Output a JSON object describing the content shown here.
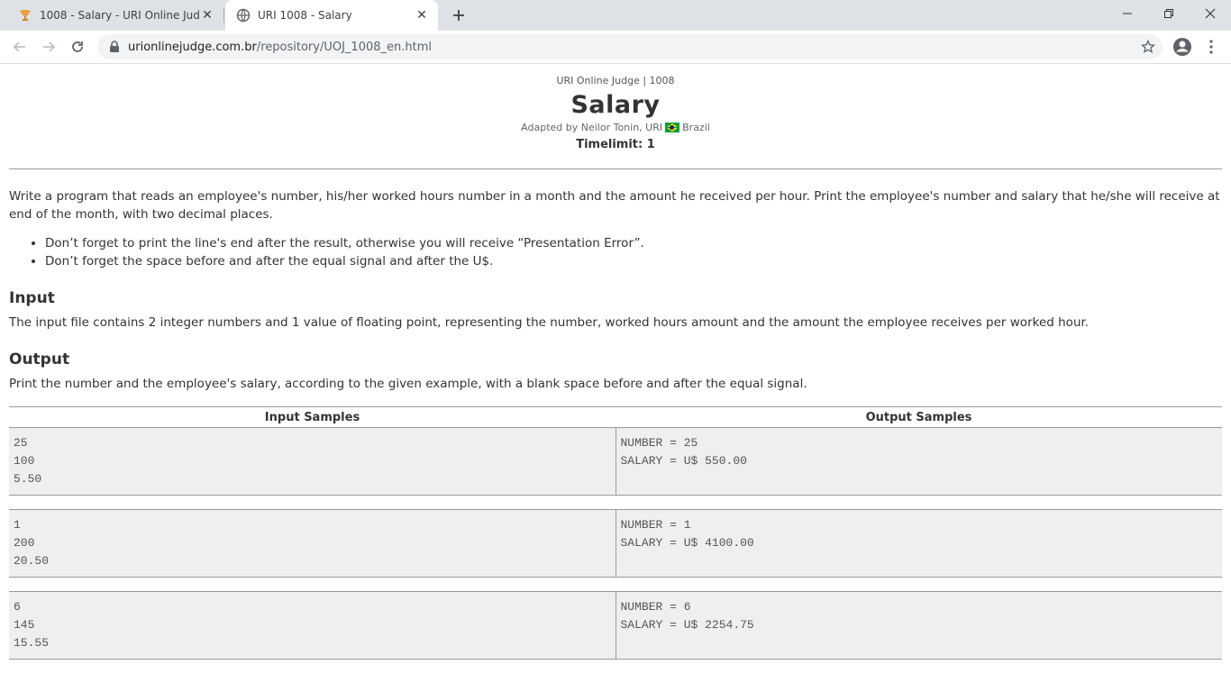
{
  "browser": {
    "tabs": [
      {
        "title": "1008 - Salary - URI Online Judge",
        "active": false
      },
      {
        "title": "URI 1008 - Salary",
        "active": true
      }
    ],
    "url_host": "urionlinejudge.com.br",
    "url_path": "/repository/UOJ_1008_en.html"
  },
  "problem": {
    "crumb": "URI Online Judge | 1008",
    "title": "Salary",
    "author_prefix": "Adapted by Neilor Tonin, URI",
    "country": "Brazil",
    "timelimit": "Timelimit: 1",
    "description": "Write a program that reads an employee's number, his/her worked hours number in a month and the amount he received per hour. Print the employee's number and salary that he/she will receive at end of the month, with two decimal places.",
    "notes": [
      "Don’t forget to print the line's end after the result, otherwise you will receive “Presentation Error”.",
      "Don’t forget the space before and after the equal signal and after the U$."
    ],
    "input_heading": "Input",
    "input_text": "The input file contains 2 integer numbers and 1 value of floating point, representing the number, worked hours amount and the amount the employee receives per worked hour.",
    "output_heading": "Output",
    "output_text": "Print the number and the employee's salary, according to the given example, with a blank space before and after the equal signal."
  },
  "samples": {
    "input_header": "Input Samples",
    "output_header": "Output Samples",
    "rows": [
      {
        "input": [
          "25",
          "100",
          "5.50"
        ],
        "output": [
          "NUMBER = 25",
          "SALARY = U$ 550.00"
        ]
      },
      {
        "input": [
          "1",
          "200",
          "20.50"
        ],
        "output": [
          "NUMBER = 1",
          "SALARY = U$ 4100.00"
        ]
      },
      {
        "input": [
          "6",
          "145",
          "15.55"
        ],
        "output": [
          "NUMBER = 6",
          "SALARY = U$ 2254.75"
        ]
      }
    ]
  }
}
